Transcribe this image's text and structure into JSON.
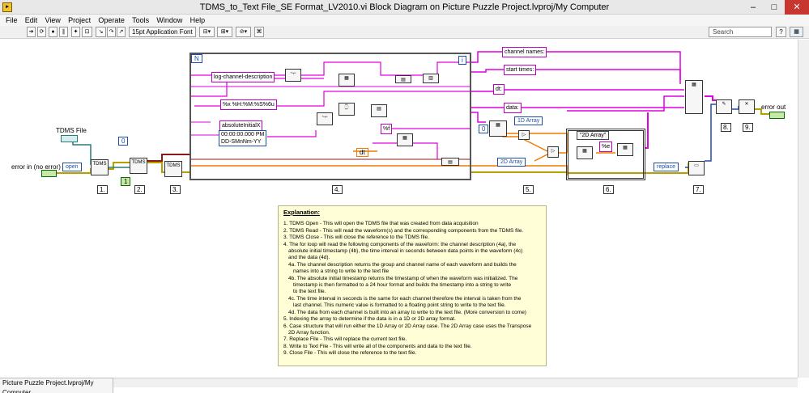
{
  "window": {
    "title": "TDMS_to_Text File_SE Format_LV2010.vi Block Diagram on Picture Puzzle Project.lvproj/My Computer",
    "minimize": "–",
    "maximize": "□",
    "close": "✕"
  },
  "menu": [
    "File",
    "Edit",
    "View",
    "Project",
    "Operate",
    "Tools",
    "Window",
    "Help"
  ],
  "toolbar": {
    "font": "15pt Application Font",
    "search_placeholder": "Search",
    "help": "?"
  },
  "diagram": {
    "tdms_file_label": "TDMS File",
    "error_in_label": "error in (no error)",
    "error_out_label": "error out",
    "open_mode": "open",
    "read_index": "0",
    "constant_one": "1",
    "replace_mode": "replace",
    "for_loop_n": "N",
    "for_loop_i": "i",
    "log_channel": "log-channel-description",
    "time_format": "%x %H:%M:%S%6u",
    "abs_initial": "absoluteInitialX",
    "time_default_line1": "00:00:00.000 PM",
    "time_default_line2": "DD-SMnNm-YY",
    "format_f": "%f",
    "format_e": "%e",
    "dt": "dt",
    "channel_names": "channel names:",
    "start_times": "start times:",
    "dt_label": "dt:",
    "data_label": "data:",
    "case_1d": "1D Array",
    "case_2d_left": "2D Array",
    "case_2d": "\"2D Array\"",
    "index_zero": "0",
    "steps": [
      "1.",
      "2.",
      "3.",
      "4.",
      "5.",
      "6.",
      "7.",
      "8.",
      "9."
    ]
  },
  "explanation": {
    "heading": "Explanation:",
    "lines": [
      "1. TDMS Open - This will open the TDMS file that was created from data acquisition",
      "2. TDMS Read - This will read the waveform(s) and the corresponding components from the TDMS file.",
      "3. TDMS Close - This will close the reference to the TDMS file.",
      "4. The for loop will read the following components of the waveform: the channel description (4a), the",
      "   absolute initial timestamp (4b), the time interval in seconds between data points in the waveform (4c)",
      "   and the data (4d).",
      "4a. The channel description returns the group and channel name of each waveform and builds the",
      "    names into a string to write to the text file",
      "4b. The absolute initial timestamp returns the timestamp of when the waveform was initialized. The",
      "    timestamp is then formatted to a 24 hour format and builds the timestamp into a string to write",
      "    to the text file.",
      "4c. The time interval in seconds is the same for each channel therefore the interval is taken from the",
      "    last channel. This numeric value is formatted to a floating point string to write to the text file.",
      "4d. The data from each channel is built into an array to write to the text file. (More conversion to come)",
      "5. Indexing the array to determine if the data is in a 1D or 2D array format.",
      "6. Case structure that will run either the 1D Array or 2D Array case. The 2D Array case uses the Transpose",
      "   2D Array function.",
      "7. Replace File - This will replace the current text file.",
      "8. Write to Text File - This will write all of the components and data to the text file.",
      "9. Close File - This will close the reference to the text file."
    ]
  },
  "statusbar": {
    "context": "Picture Puzzle Project.lvproj/My Computer"
  },
  "colors": {
    "string_wire": "#e000e0",
    "numeric_wire": "#f07a00",
    "error_wire": "#b4a000",
    "refnum_wire": "#2a7a7a",
    "dark_wire": "#8a1a1a",
    "note_bg": "#fffed6"
  }
}
